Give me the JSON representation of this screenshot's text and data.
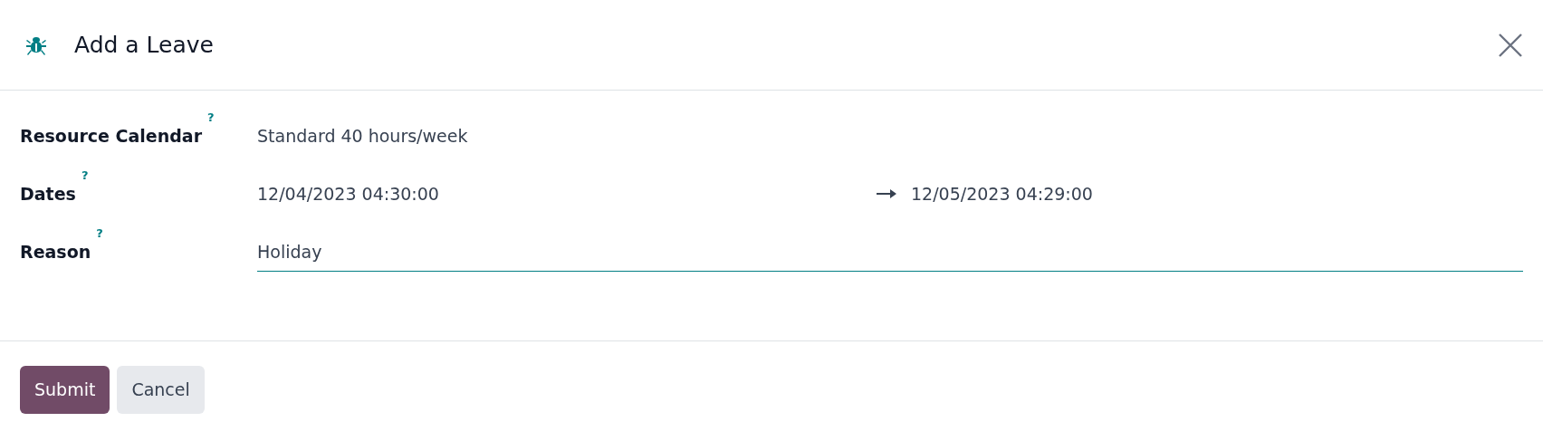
{
  "dialog": {
    "title": "Add a Leave"
  },
  "fields": [
    {
      "kind": "text",
      "label": "Resource Calendar",
      "help": "?",
      "value": "Standard 40 hours/week"
    },
    {
      "kind": "daterange",
      "label": "Dates",
      "help": "?",
      "start": "12/04/2023 04:30:00",
      "end": "12/05/2023 04:29:00"
    },
    {
      "kind": "input",
      "label": "Reason",
      "help": "?",
      "value": "Holiday"
    }
  ],
  "buttons": [
    {
      "label": "Submit",
      "kind": "primary"
    },
    {
      "label": "Cancel",
      "kind": "secondary"
    }
  ]
}
